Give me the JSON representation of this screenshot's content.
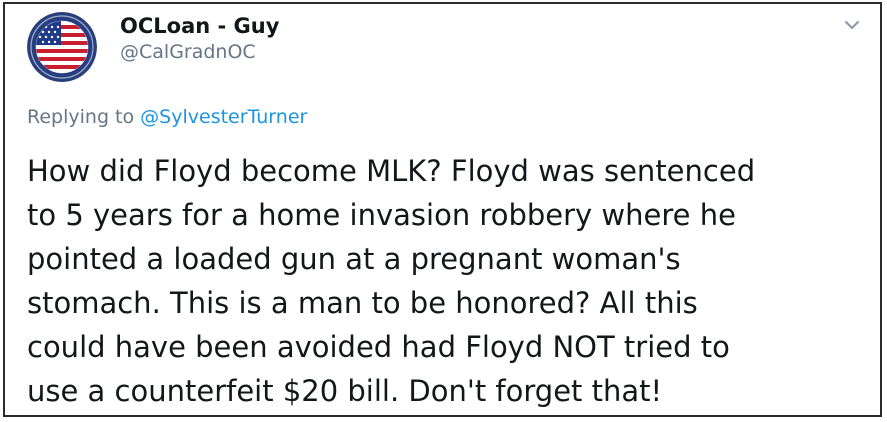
{
  "user": {
    "display_name": "OCLoan - Guy",
    "handle": "@CalGradnOC",
    "avatar_icon": "us-flag-seal-icon"
  },
  "header": {
    "menu_icon": "chevron-down-icon"
  },
  "reply": {
    "prefix": "Replying to",
    "target": "@SylvesterTurner"
  },
  "tweet": {
    "lines": [
      "How did Floyd become MLK? Floyd was sentenced",
      "to 5 years for a home invasion robbery where he",
      "pointed a loaded gun at a pregnant woman's",
      "stomach. This is a man to be honored? All this",
      "could have been avoided had Floyd NOT tried to",
      "use a counterfeit $20 bill. Don't forget that!"
    ]
  },
  "colors": {
    "link": "#1b95e0",
    "muted": "#657786",
    "text": "#14171a",
    "border": "#2b2b2b"
  }
}
